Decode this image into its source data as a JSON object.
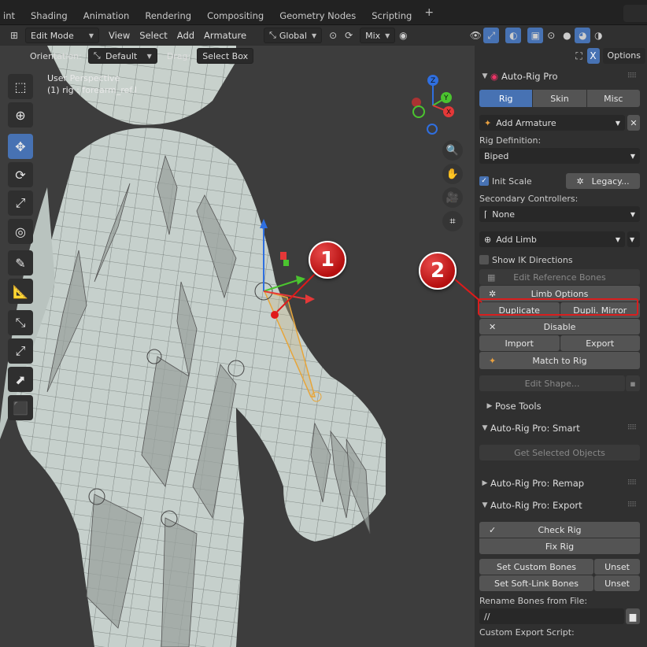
{
  "workspace_tabs": [
    "int",
    "Shading",
    "Animation",
    "Rendering",
    "Compositing",
    "Geometry Nodes",
    "Scripting"
  ],
  "header": {
    "mode": "Edit Mode",
    "menus": [
      "View",
      "Select",
      "Add",
      "Armature"
    ],
    "transform": "Global",
    "blend": "Mix"
  },
  "subheader": {
    "orientation_label": "Orientation:",
    "orientation": "Default",
    "drag_label": "Drag:",
    "drag": "Select Box"
  },
  "viewport": {
    "line1": "User Perspective",
    "line2": "(1) rig : forearm_ref.l"
  },
  "panel": {
    "options": "Options",
    "title": "Auto-Rig Pro",
    "tabs": [
      "Rig",
      "Skin",
      "Misc"
    ],
    "add_armature": "Add Armature",
    "rig_def_label": "Rig Definition:",
    "rig_def": "Biped",
    "init_scale": "Init Scale",
    "legacy": "Legacy...",
    "secondary_label": "Secondary Controllers:",
    "secondary": "None",
    "add_limb": "Add Limb",
    "show_ik": "Show IK Directions",
    "edit_ref": "Edit Reference Bones",
    "limb_options": "Limb Options",
    "duplicate": "Duplicate",
    "dupli_mirror": "Dupli. Mirror",
    "disable": "Disable",
    "import": "Import",
    "export": "Export",
    "match_rig": "Match to Rig",
    "edit_shape": "Edit Shape...",
    "pose_tools": "Pose Tools",
    "smart_title": "Auto-Rig Pro: Smart",
    "get_selected": "Get Selected Objects",
    "remap_title": "Auto-Rig Pro: Remap",
    "export_title": "Auto-Rig Pro: Export",
    "check_rig": "Check Rig",
    "fix_rig": "Fix Rig",
    "set_custom": "Set Custom Bones",
    "unset": "Unset",
    "set_soft": "Set Soft-Link Bones",
    "rename_label": "Rename Bones from File:",
    "path": "//",
    "custom_export": "Custom Export Script:"
  },
  "callouts": [
    "1",
    "2"
  ],
  "colors": {
    "accent": "#4772b3",
    "highlight": "#d81e1e"
  }
}
